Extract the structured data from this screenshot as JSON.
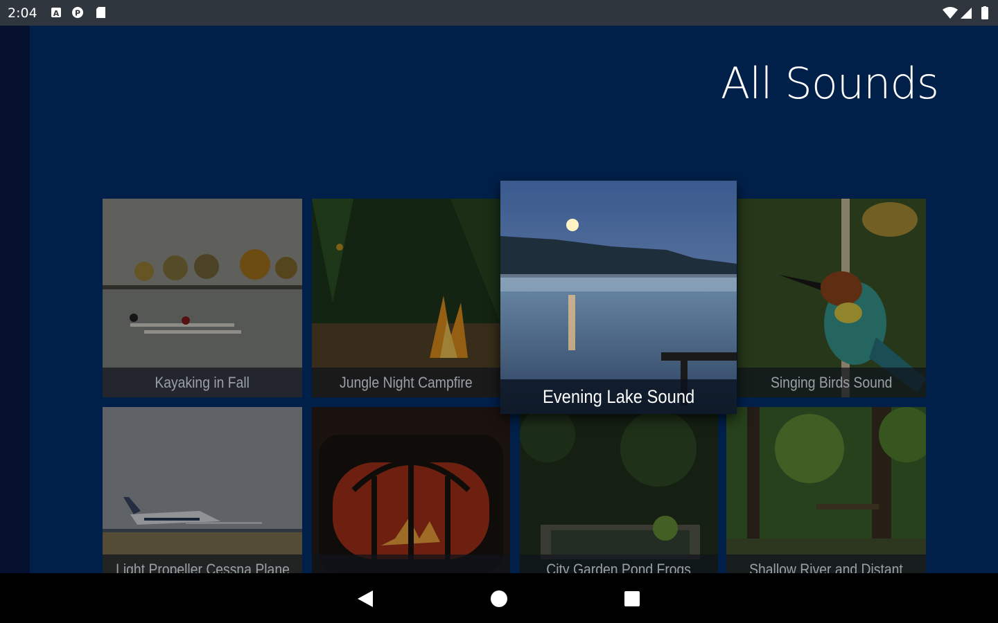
{
  "status_bar": {
    "time": "2:04",
    "icons": [
      "a-notification-icon",
      "p-notification-icon",
      "sd-card-icon",
      "wifi-icon",
      "cell-signal-icon",
      "battery-icon"
    ]
  },
  "page": {
    "title": "All Sounds"
  },
  "sounds": [
    {
      "label": "Kayaking in Fall"
    },
    {
      "label": "Jungle Night Campfire"
    },
    {
      "label": "Evening Lake Sound",
      "focused": true
    },
    {
      "label": "Singing Birds Sound"
    },
    {
      "label": "Light Propeller Cessna Plane"
    },
    {
      "label": ""
    },
    {
      "label": "City Garden Pond Frogs"
    },
    {
      "label": "Shallow River and Distant"
    }
  ],
  "nav_bar": {
    "buttons": [
      "back-icon",
      "home-icon",
      "recents-icon"
    ]
  },
  "colors": {
    "background": "#00204a",
    "status_bar": "#2f363d",
    "nav_bar": "#000000"
  }
}
